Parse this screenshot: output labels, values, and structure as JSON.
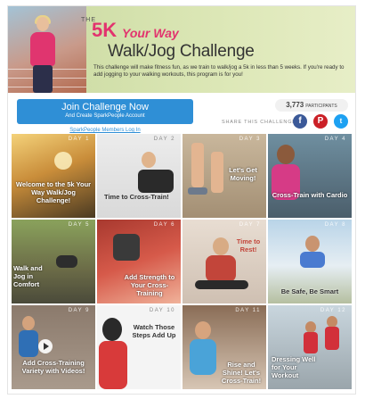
{
  "banner": {
    "the": "THE",
    "five_k": "5K",
    "your_way": "Your Way",
    "title": "Walk/Jog Challenge",
    "description": "This challenge will make fitness fun, as we train to walk/jog a 5k in less than 5 weeks. If you're ready to add jogging to your walking workouts, this program is for you!"
  },
  "join": {
    "title": "Join Challenge Now",
    "subtitle": "And Create SparkPeople Account",
    "login_link": "SparkPeople Members Log In"
  },
  "participants": {
    "count": "3,773",
    "label": "PARTICIPANTS"
  },
  "share": {
    "label": "SHARE THIS CHALLENGE"
  },
  "colors": {
    "accent_blue": "#2f8fd6",
    "brand_pink": "#e2336e",
    "banner_green": "#d4e1ab"
  },
  "tiles": [
    {
      "day": "DAY 1",
      "caption": "Welcome to the 5k Your Way Walk/Jog Challenge!"
    },
    {
      "day": "DAY 2",
      "caption": "Time to Cross-Train!"
    },
    {
      "day": "DAY 3",
      "caption": "Let's Get Moving!"
    },
    {
      "day": "DAY 4",
      "caption": "Cross-Train with Cardio"
    },
    {
      "day": "DAY 5",
      "caption": "Walk and Jog in Comfort"
    },
    {
      "day": "DAY 6",
      "caption": "Add Strength to Your Cross-Training"
    },
    {
      "day": "DAY 7",
      "caption": "Time to Rest!"
    },
    {
      "day": "DAY 8",
      "caption": "Be Safe, Be Smart"
    },
    {
      "day": "DAY 9",
      "caption": "Add Cross-Training Variety with Videos!"
    },
    {
      "day": "DAY 10",
      "caption": "Watch Those Steps Add Up"
    },
    {
      "day": "DAY 11",
      "caption": "Rise and Shine! Let's Cross-Train!"
    },
    {
      "day": "DAY 12",
      "caption": "Dressing Well for Your Workout"
    }
  ]
}
